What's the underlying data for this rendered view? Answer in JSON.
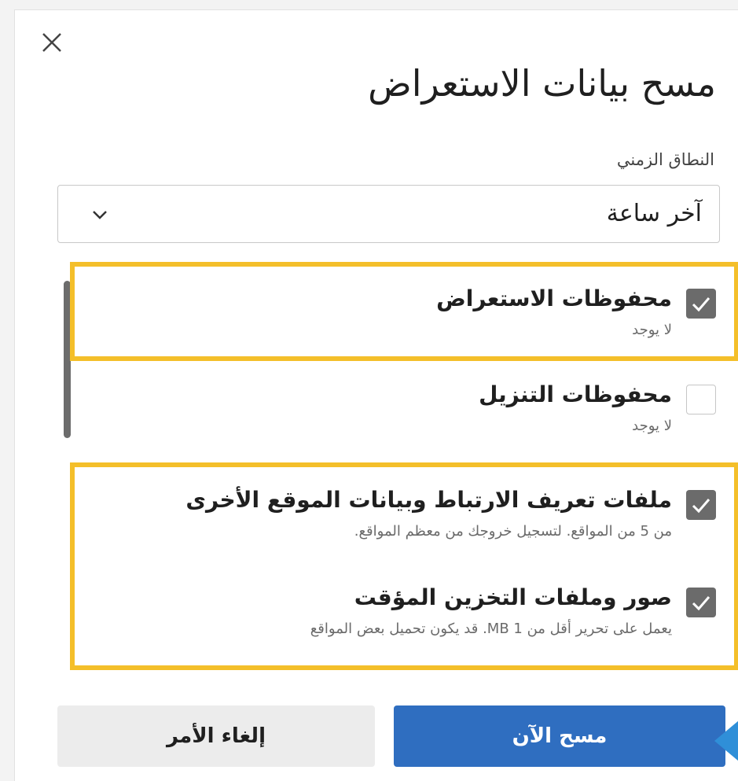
{
  "dialog": {
    "title": "مسح بيانات الاستعراض",
    "close_icon": "close-icon"
  },
  "time_range": {
    "label": "النطاق الزمني",
    "selected": "آخر ساعة",
    "chevron_icon": "chevron-down-icon"
  },
  "items": [
    {
      "title": "محفوظات الاستعراض",
      "subtitle": "لا يوجد",
      "checked": true
    },
    {
      "title": "محفوظات التنزيل",
      "subtitle": "لا يوجد",
      "checked": false
    },
    {
      "title": "ملفات تعريف الارتباط وبيانات الموقع الأخرى",
      "subtitle": "من 5 من المواقع. لتسجيل خروجك من معظم المواقع.",
      "checked": true
    },
    {
      "title": "صور وملفات التخزين المؤقت",
      "subtitle": "يعمل على تحرير أقل من 1 MB. قد يكون تحميل بعض المواقع",
      "checked": true
    }
  ],
  "buttons": {
    "clear_now": "مسح الآن",
    "cancel": "إلغاء الأمر"
  },
  "colors": {
    "highlight": "#f4bf2a",
    "primary": "#2f6ec0",
    "checkbox_checked": "#6b6b6b"
  }
}
